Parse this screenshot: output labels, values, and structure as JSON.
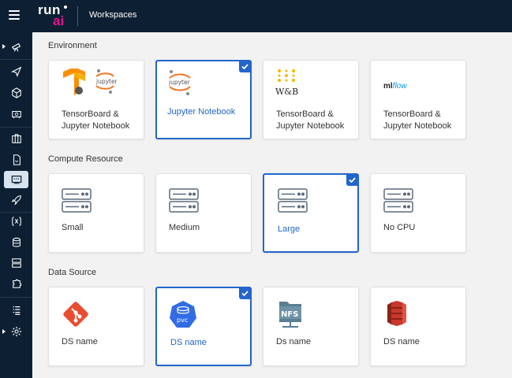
{
  "header": {
    "title": "Workspaces",
    "logo_top": "run",
    "logo_bottom": "ai"
  },
  "sidebar": {
    "items": [
      {
        "icon": "telescope-icon"
      },
      {
        "icon": "send-icon"
      },
      {
        "icon": "cube-icon"
      },
      {
        "icon": "gpu-card-icon"
      },
      {
        "icon": "briefcase-icon"
      },
      {
        "icon": "file-icon"
      },
      {
        "icon": "workspace-icon",
        "active": true
      },
      {
        "icon": "rocket-icon"
      },
      {
        "icon": "variable-icon"
      },
      {
        "icon": "database-icon"
      },
      {
        "icon": "server-icon"
      },
      {
        "icon": "puzzle-icon"
      },
      {
        "icon": "list-icon"
      },
      {
        "icon": "gear-icon"
      }
    ]
  },
  "sections": {
    "environment": {
      "title": "Environment",
      "cards": [
        {
          "label": "TensorBoard & Jupyter Notebook",
          "icon": "tensorflow-jupyter-icon",
          "selected": false
        },
        {
          "label": "Jupyter Notebook",
          "icon": "jupyter-icon",
          "selected": true
        },
        {
          "label": "TensorBoard & Jupyter Notebook",
          "icon": "wandb-icon",
          "icon_text": "W&B",
          "selected": false
        },
        {
          "label": "TensorBoard & Jupyter Notebook",
          "icon": "mlflow-icon",
          "icon_text_a": "ml",
          "icon_text_b": "flow",
          "selected": false
        }
      ],
      "jupyter_text": "jupyter"
    },
    "compute": {
      "title": "Compute Resource",
      "cards": [
        {
          "label": "Small",
          "icon": "server-icon",
          "selected": false
        },
        {
          "label": "Medium",
          "icon": "server-icon",
          "selected": false
        },
        {
          "label": "Large",
          "icon": "server-icon",
          "selected": true
        },
        {
          "label": "No CPU",
          "icon": "server-icon",
          "selected": false
        }
      ]
    },
    "datasource": {
      "title": "Data Source",
      "cards": [
        {
          "label": "DS name",
          "icon": "git-icon",
          "selected": false
        },
        {
          "label": "DS name",
          "icon": "pvc-icon",
          "icon_text": "pvc",
          "selected": true
        },
        {
          "label": "Ds name",
          "icon": "nfs-icon",
          "icon_text": "NFS",
          "selected": false
        },
        {
          "label": "DS name",
          "icon": "s3-icon",
          "selected": false
        }
      ]
    }
  },
  "colors": {
    "header_bg": "#0d2033",
    "accent": "#2266cc",
    "logo_ai": "#e0148c"
  }
}
